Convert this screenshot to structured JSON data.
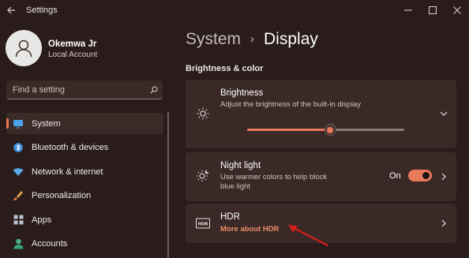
{
  "window": {
    "title": "Settings",
    "controls": {
      "minimize": "—",
      "maximize": "☐",
      "close": "✕"
    }
  },
  "user": {
    "name": "Okemwa Jr",
    "account_type": "Local Account"
  },
  "search": {
    "placeholder": "Find a setting"
  },
  "sidebar": {
    "items": [
      {
        "label": "System",
        "icon": "monitor-icon",
        "active": true
      },
      {
        "label": "Bluetooth & devices",
        "icon": "bluetooth-icon",
        "active": false
      },
      {
        "label": "Network & internet",
        "icon": "wifi-icon",
        "active": false
      },
      {
        "label": "Personalization",
        "icon": "brush-icon",
        "active": false
      },
      {
        "label": "Apps",
        "icon": "apps-icon",
        "active": false
      },
      {
        "label": "Accounts",
        "icon": "person-icon",
        "active": false
      }
    ]
  },
  "breadcrumb": {
    "parent": "System",
    "separator": "›",
    "current": "Display"
  },
  "section": {
    "title": "Brightness & color"
  },
  "brightness": {
    "title": "Brightness",
    "description": "Adjust the brightness of the built-in display",
    "level": 0.53
  },
  "night_light": {
    "title": "Night light",
    "description_line1": "Use warmer colors to help block",
    "description_line2": "blue light",
    "state_label": "On",
    "enabled": true
  },
  "hdr": {
    "title": "HDR",
    "link": "More about HDR",
    "icon_text": "HDR"
  },
  "colors": {
    "accent": "#e8795a",
    "background": "#2a1c1a",
    "card": "#3a2926",
    "annotation_arrow": "#d4201a"
  }
}
